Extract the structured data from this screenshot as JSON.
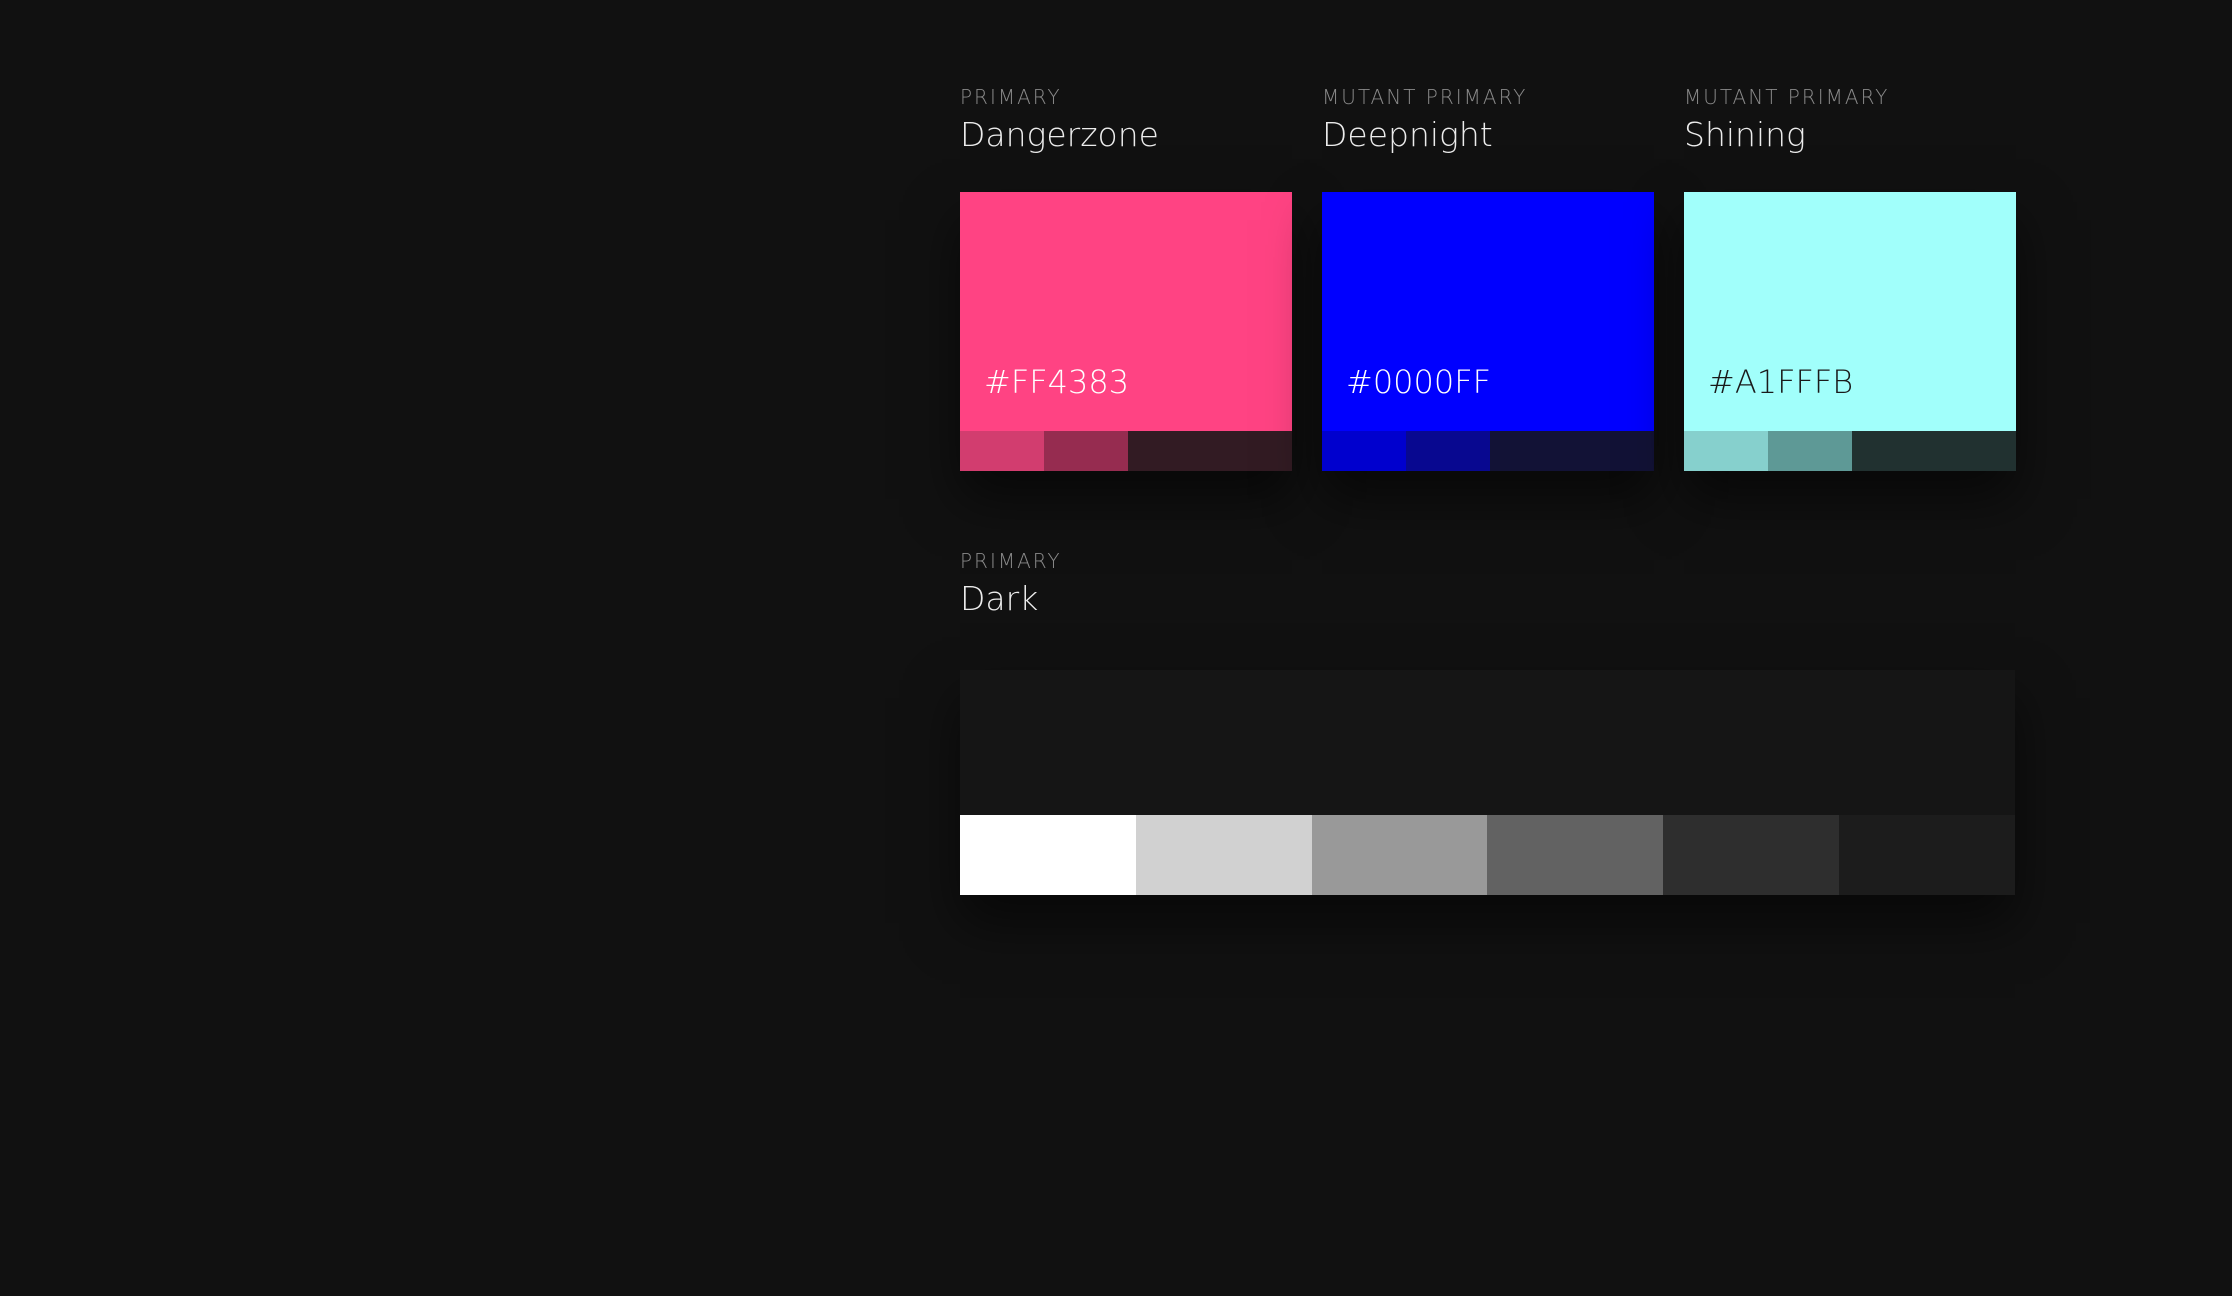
{
  "palettes": [
    {
      "eyebrow": "PRIMARY",
      "name": "Dangerzone",
      "hex": "#FF4383",
      "color": "#FF4383",
      "text_color": "#FFFFFF",
      "shades": [
        "#D23D6F",
        "#962C50",
        "#321B23"
      ]
    },
    {
      "eyebrow": "MUTANT PRIMARY",
      "name": "Deepnight",
      "hex": "#0000FF",
      "color": "#0000FF",
      "text_color": "#FFFFFF",
      "shades": [
        "#0000CE",
        "#080890",
        "#121236"
      ]
    },
    {
      "eyebrow": "MUTANT PRIMARY",
      "name": "Shining",
      "hex": "#A1FFFB",
      "color": "#A1FFFB",
      "text_color": "#1A1A1A",
      "shades": [
        "#86D0CD",
        "#5E9996",
        "#213130"
      ]
    }
  ],
  "dark": {
    "eyebrow": "PRIMARY",
    "name": "Dark",
    "greys": [
      "#FFFFFF",
      "#D1D1D1",
      "#999999",
      "#626262",
      "#2E2E2E",
      "#1C1C1C"
    ]
  }
}
